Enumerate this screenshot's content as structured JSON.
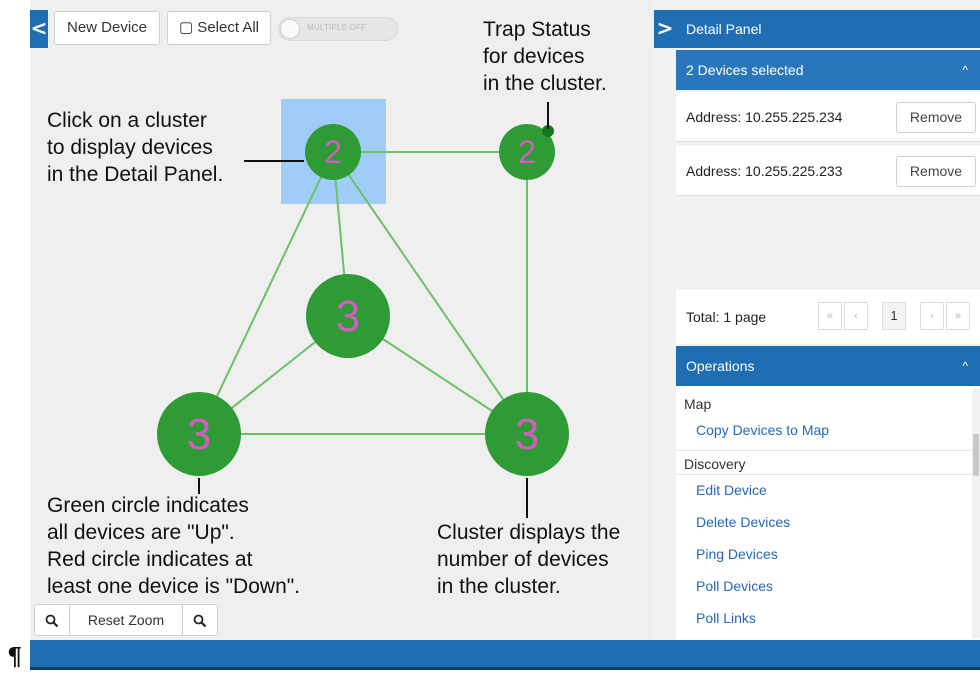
{
  "map": {
    "collapse_glyph": "<",
    "toolbar": {
      "new_device_label": "New Device",
      "select_all_label": "▢ Select All",
      "multiple_toggle_label": "MULTIPLE OFF"
    },
    "clusters": [
      {
        "count": "2",
        "color": "#2e9b35",
        "selected": true
      },
      {
        "count": "2",
        "color": "#2e9b35",
        "trap_status": true
      },
      {
        "count": "3",
        "color": "#2e9b35"
      },
      {
        "count": "3",
        "color": "#2e9b35"
      },
      {
        "count": "3",
        "color": "#2e9b35"
      }
    ],
    "annotations": {
      "click_cluster": [
        "Click on a cluster",
        "to display devices",
        "in the Detail Panel."
      ],
      "trap_status": [
        "Trap Status",
        "for devices",
        "in the cluster."
      ],
      "circle_color": [
        "Green circle indicates",
        "all devices are \"Up\".",
        "Red circle indicates at",
        "least one device is \"Down\"."
      ],
      "cluster_count": [
        "Cluster displays the",
        "number of devices",
        "in the cluster."
      ]
    },
    "zoom": {
      "zoom_out_icon": "zoom-out-icon",
      "reset_label": "Reset Zoom",
      "zoom_in_icon": "zoom-in-icon"
    }
  },
  "detail_panel": {
    "expand_glyph": ">",
    "title": "Detail Panel",
    "selection_header": "2 Devices selected",
    "caret": "^",
    "devices": [
      {
        "address": "Address: 10.255.225.234",
        "remove_label": "Remove"
      },
      {
        "address": "Address: 10.255.225.233",
        "remove_label": "Remove"
      }
    ],
    "pager": {
      "total": "Total: 1 page",
      "first": "«",
      "prev": "‹",
      "page": "1",
      "next": "›",
      "last": "»"
    },
    "operations": {
      "title": "Operations",
      "caret": "^",
      "groups": [
        {
          "name": "Map",
          "items": [
            "Copy Devices to Map"
          ]
        },
        {
          "name": "Discovery",
          "items": [
            "Edit Device",
            "Delete Devices",
            "Ping Devices",
            "Poll Devices",
            "Poll Links"
          ]
        }
      ]
    }
  },
  "document": {
    "pilcrow": "¶"
  },
  "colors": {
    "accent_blue": "#1f6db3",
    "cluster_green": "#2e9b35",
    "cluster_number": "#d25ec2",
    "link_green": "#6cc068",
    "selection_box": "#9fcdf7",
    "trap_dot": "#127a1a"
  }
}
